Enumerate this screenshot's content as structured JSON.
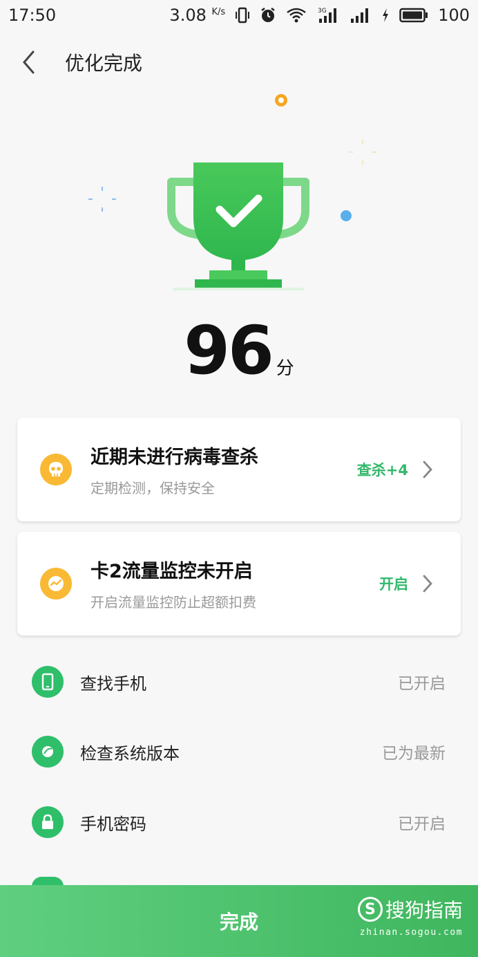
{
  "status_bar": {
    "time": "17:50",
    "speed_value": "3.08",
    "speed_unit": "K/s",
    "network_badge": "3G",
    "battery": "100",
    "icons": [
      "vibrate-icon",
      "alarm-icon",
      "wifi-icon",
      "signal-3g-icon",
      "signal-icon",
      "charging-icon",
      "battery-icon"
    ]
  },
  "header": {
    "title": "优化完成",
    "back_icon": "chevron-left-icon"
  },
  "score": {
    "value": "96",
    "unit": "分"
  },
  "cards": [
    {
      "title": "近期未进行病毒查杀",
      "subtitle": "定期检测，保持安全",
      "action": "查杀+4",
      "icon": "skull-icon"
    },
    {
      "title": "卡2流量监控未开启",
      "subtitle": "开启流量监控防止超额扣费",
      "action": "开启",
      "icon": "traffic-monitor-icon"
    }
  ],
  "list": [
    {
      "label": "查找手机",
      "status": "已开启",
      "icon": "phone-icon"
    },
    {
      "label": "检查系统版本",
      "status": "已为最新",
      "icon": "system-version-icon"
    },
    {
      "label": "手机密码",
      "status": "已开启",
      "icon": "lock-icon"
    }
  ],
  "footer": {
    "done_label": "完成"
  },
  "watermark": {
    "brand": "搜狗指南",
    "url": "zhinan.sogou.com"
  },
  "colors": {
    "accent_green": "#33b86b",
    "warning_yellow": "#f9b934",
    "button_green": "#4cc06a"
  }
}
